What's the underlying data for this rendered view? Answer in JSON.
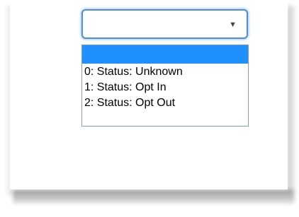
{
  "select": {
    "value": "",
    "caret_icon": "caret-down-icon"
  },
  "options": [
    {
      "label": ""
    },
    {
      "label": "0: Status: Unknown"
    },
    {
      "label": "1: Status: Opt In"
    },
    {
      "label": "2: Status: Opt Out"
    }
  ],
  "colors": {
    "focus_border": "#4f8fd8",
    "highlight": "#1e90ff",
    "list_border": "#7a9ccf"
  }
}
